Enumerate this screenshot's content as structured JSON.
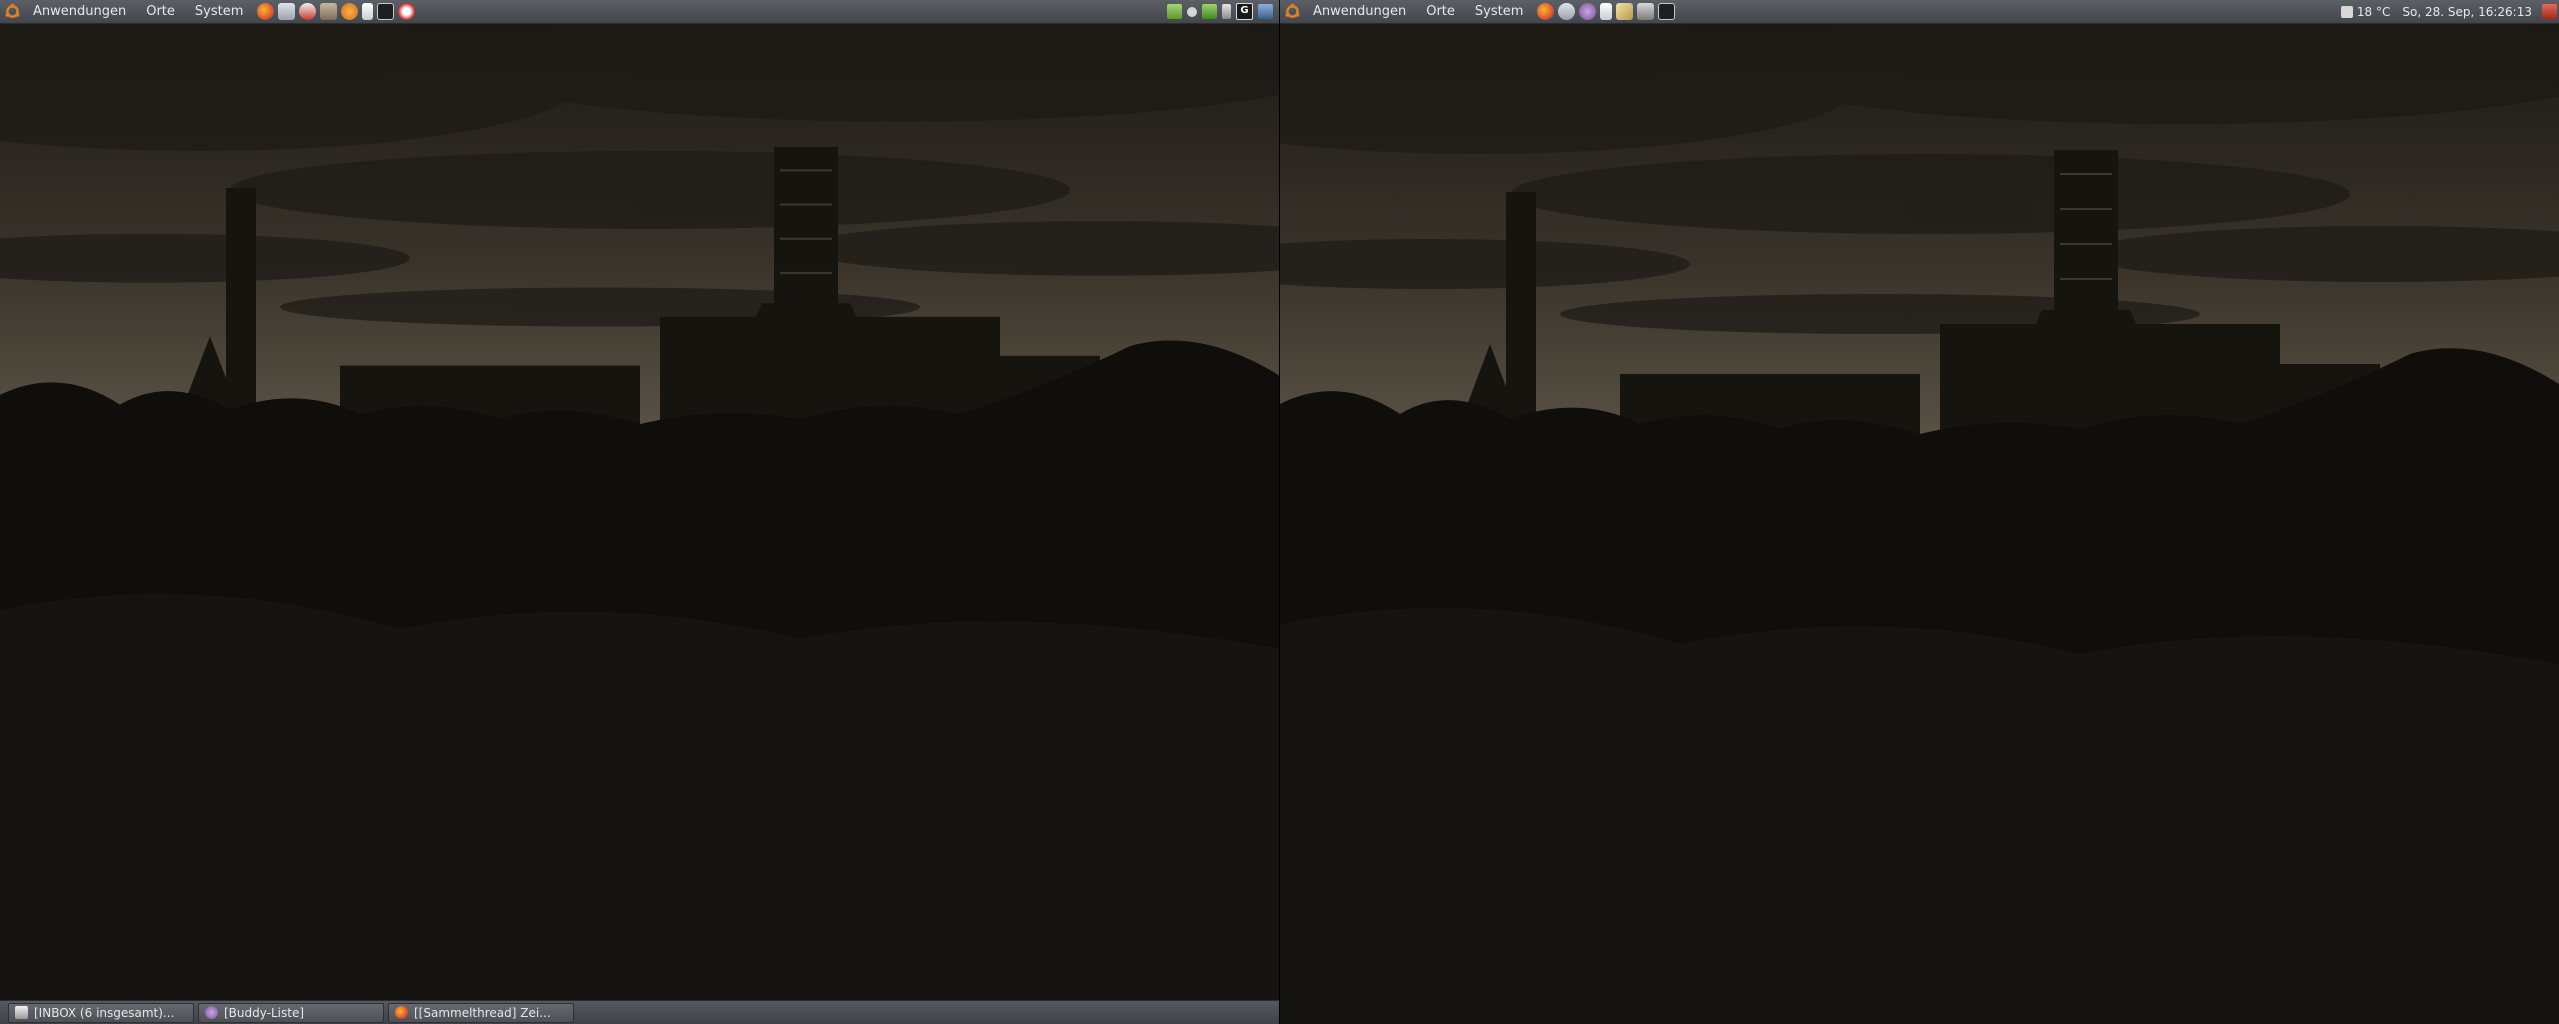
{
  "left_panel": {
    "menus": [
      "Anwendungen",
      "Orte",
      "System"
    ],
    "launchers": [
      "firefox-icon",
      "network-icon",
      "mail-icon",
      "gimp-icon",
      "blender-icon",
      "text-editor-icon",
      "terminal-icon",
      "camera-icon"
    ],
    "tray": [
      "files-icon",
      "status-icon",
      "network-status-icon",
      "battery-icon",
      "g-icon",
      "display-icon"
    ]
  },
  "right_panel": {
    "menus": [
      "Anwendungen",
      "Orte",
      "System"
    ],
    "launchers": [
      "firefox-icon",
      "network-icon",
      "pidgin-icon",
      "document-icon",
      "text-editor-icon",
      "calculator-icon",
      "terminal-icon"
    ],
    "weather": "18 °C",
    "clock": "So, 28. Sep, 16:26:13"
  },
  "taskbar": [
    {
      "label": "[INBOX (6 insgesamt)...",
      "icon": "mail-icon"
    },
    {
      "label": "[Buddy-Liste]",
      "icon": "pidgin-icon"
    },
    {
      "label": "[[Sammelthread] Zei...",
      "icon": "firefox-icon"
    }
  ]
}
